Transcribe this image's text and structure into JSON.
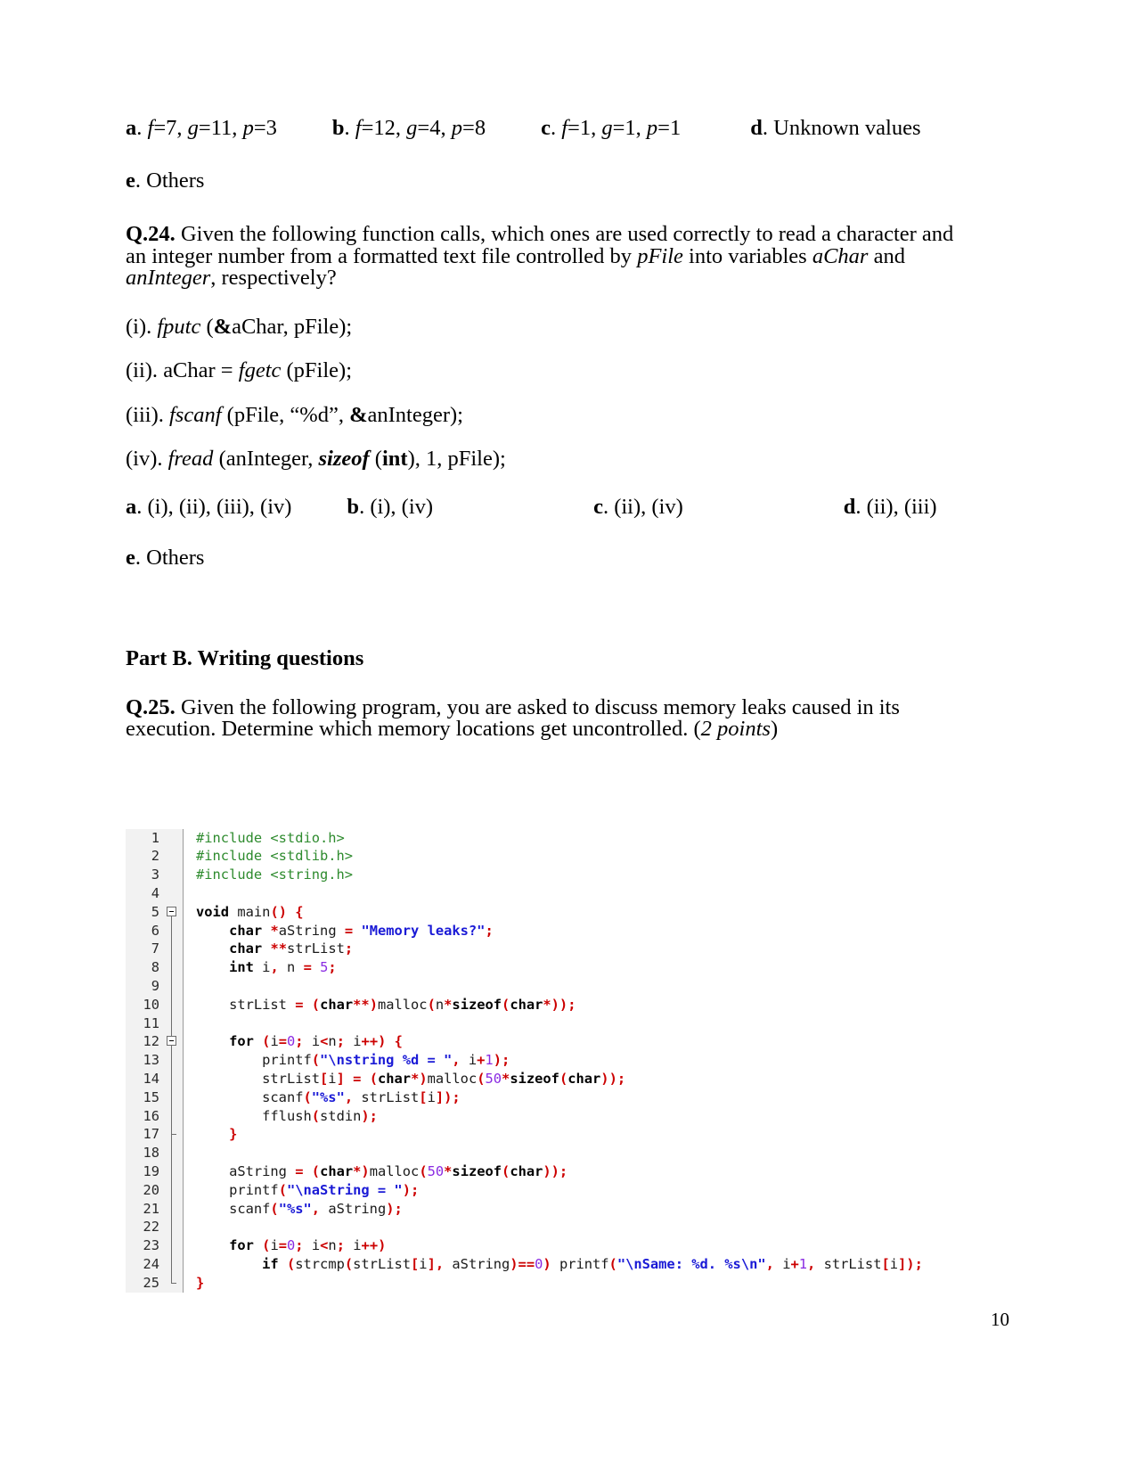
{
  "page": {
    "number": "10"
  },
  "q23_options": {
    "a_label": "a",
    "a_text": ". f=7, g=11, p=3",
    "b_label": "b",
    "b_text": ". f=12, g=4, p=8",
    "c_label": "c",
    "c_text": ". f=1, g=1, p=1",
    "d_label": "d",
    "d_text": ". Unknown values",
    "e_label": "e",
    "e_text": ". Others",
    "a_parts": {
      "f": "f",
      "eq1": "=7, ",
      "g": "g",
      "eq2": "=11, ",
      "p": "p",
      "eq3": "=3"
    },
    "b_parts": {
      "f": "f",
      "eq1": "=12, ",
      "g": "g",
      "eq2": "=4, ",
      "p": "p",
      "eq3": "=8"
    },
    "c_parts": {
      "f": "f",
      "eq1": "=1, ",
      "g": "g",
      "eq2": "=1, ",
      "p": "p",
      "eq3": "=1"
    }
  },
  "q24": {
    "number": "Q.24.",
    "text_1": "Given the following function calls, which ones are used correctly to read a character and an integer number from a formatted text file controlled by ",
    "pfile": "pFile",
    "text_2": " into variables ",
    "achar": "aChar",
    "text_3": " and ",
    "aninteger": "anInteger",
    "text_4": ", respectively?",
    "items": [
      {
        "label": "(i). ",
        "fn": "fputc",
        "rest_pre": " (",
        "amp": "&",
        "rest": "aChar, pFile);"
      },
      {
        "label": "(ii). ",
        "pre": "aChar = ",
        "fn": "fgetc",
        "rest": " (pFile);"
      },
      {
        "label": "(iii). ",
        "fn": "fscanf",
        "rest_pre": " (pFile, “%d”, ",
        "amp": "&",
        "rest": "anInteger);"
      },
      {
        "label": "(iv). ",
        "fn": "fread",
        "rest_pre": " (anInteger, ",
        "sizeof": "sizeof",
        "mid": " (",
        "int": "int",
        "rest": "), 1, pFile);"
      }
    ],
    "options": {
      "a_label": "a",
      "a_text": ". (i), (ii), (iii), (iv)",
      "b_label": "b",
      "b_text": ". (i), (iv)",
      "c_label": "c",
      "c_text": ". (ii), (iv)",
      "d_label": "d",
      "d_text": ". (ii), (iii)",
      "e_label": "e",
      "e_text": ". Others"
    }
  },
  "part_b": {
    "heading": "Part B. Writing questions"
  },
  "q25": {
    "number": "Q.25.",
    "text_1": "Given the following program, you are asked to discuss memory leaks caused in its execution. Determine which memory locations get uncontrolled. (",
    "points": "2 points",
    "text_2": ")"
  },
  "code": {
    "language": "c",
    "line_numbers": [
      "1",
      "2",
      "3",
      "4",
      "5",
      "6",
      "7",
      "8",
      "9",
      "10",
      "11",
      "12",
      "13",
      "14",
      "15",
      "16",
      "17",
      "18",
      "19",
      "20",
      "21",
      "22",
      "23",
      "24",
      "25"
    ],
    "lines": [
      "#include <stdio.h>",
      "#include <stdlib.h>",
      "#include <string.h>",
      "",
      "void main() {",
      "    char *aString = \"Memory leaks?\";",
      "    char **strList;",
      "    int i, n = 5;",
      "",
      "    strList = (char**)malloc(n*sizeof(char*));",
      "",
      "    for (i=0; i<n; i++) {",
      "        printf(\"\\nstring %d = \", i+1);",
      "        strList[i] = (char*)malloc(50*sizeof(char));",
      "        scanf(\"%s\", strList[i]);",
      "        fflush(stdin);",
      "    }",
      "",
      "    aString = (char*)malloc(50*sizeof(char));",
      "    printf(\"\\naString = \");",
      "    scanf(\"%s\", aString);",
      "",
      "    for (i=0; i<n; i++)",
      "        if (strcmp(strList[i], aString)==0) printf(\"\\nSame: %d. %s\\n\", i+1, strList[i]);",
      "}"
    ],
    "fold_markers": {
      "open": [
        "5",
        "12"
      ],
      "close": [
        "17",
        "25"
      ]
    },
    "colors": {
      "preprocessor": "#2e8b2e",
      "keyword": "#000000",
      "string": "#1a1ad6",
      "punctuation": "#cc0000",
      "number": "#8a2be2",
      "gutter_bg": "#f2f2f2",
      "plain": "#1a1a1a"
    }
  }
}
